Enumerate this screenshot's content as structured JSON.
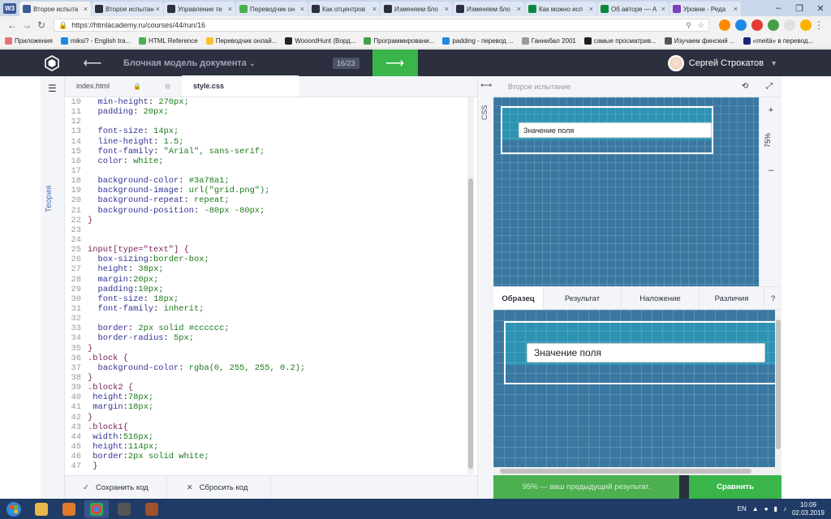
{
  "browser": {
    "tabs": [
      {
        "title": "Второе испыта",
        "fav_color": "#3d5a9a",
        "active": true
      },
      {
        "title": "Второе испытан",
        "fav_color": "#2b2f3e",
        "active": false
      },
      {
        "title": "Управление те",
        "fav_color": "#2b2f3e",
        "active": false
      },
      {
        "title": "Переводчик он",
        "fav_color": "#4caf50",
        "active": false
      },
      {
        "title": "Как отцентров",
        "fav_color": "#2b2f3e",
        "active": false
      },
      {
        "title": "Изменяем бло",
        "fav_color": "#2b2f3e",
        "active": false
      },
      {
        "title": "Изменяем бло",
        "fav_color": "#2b2f3e",
        "active": false
      },
      {
        "title": "Как можно исп",
        "fav_color": "#0b8a3e",
        "active": false
      },
      {
        "title": "Об авторе — А",
        "fav_color": "#0b8a3e",
        "active": false
      },
      {
        "title": "Уровни - Реда",
        "fav_color": "#7b3fbf",
        "active": false
      }
    ],
    "app_icon": "W3",
    "url": "https://htmlacademy.ru/courses/44/run/16",
    "bookmarks": [
      {
        "label": "Приложения",
        "color": "#e57373"
      },
      {
        "label": "miksi? - English tra...",
        "color": "#1e88e5"
      },
      {
        "label": "HTML Reference",
        "color": "#4caf50"
      },
      {
        "label": "Переводчик онлай...",
        "color": "#fbc02d"
      },
      {
        "label": "WooordHunt (Ворд...",
        "color": "#222222"
      },
      {
        "label": "Программировани...",
        "color": "#43a047"
      },
      {
        "label": "padding - перевод ...",
        "color": "#1e88e5"
      },
      {
        "label": "Ганнибал 2001",
        "color": "#999999"
      },
      {
        "label": "самые просматрив...",
        "color": "#1e1e1e"
      },
      {
        "label": "Изучаем финский ...",
        "color": "#555555"
      },
      {
        "label": "«meitä» в перевод...",
        "color": "#1a237e"
      }
    ]
  },
  "app": {
    "course_title": "Блочная модель документа",
    "counter": "16/23",
    "user_name": "Сергей Строкатов",
    "theory_label": "Теория",
    "files": {
      "html": "index.html",
      "css": "style.css"
    },
    "css_label": "CSS",
    "preview_title": "Второе испытание",
    "zoom": "75%",
    "field_value": "Значение поля",
    "preview_tabs": [
      "Образец",
      "Результат",
      "Наложение",
      "Различия",
      "?"
    ],
    "save_label": "Сохранить код",
    "reset_label": "Сбросить код",
    "result_message": "95% — ваш предыдущий результат.",
    "compare_label": "Сравнить"
  },
  "code_lines": [
    {
      "n": "10",
      "t": "  min-height: 270px;"
    },
    {
      "n": "11",
      "t": "  padding: 20px;"
    },
    {
      "n": "12",
      "t": ""
    },
    {
      "n": "13",
      "t": "  font-size: 14px;"
    },
    {
      "n": "14",
      "t": "  line-height: 1.5;"
    },
    {
      "n": "15",
      "t": "  font-family: \"Arial\", sans-serif;"
    },
    {
      "n": "16",
      "t": "  color: white;"
    },
    {
      "n": "17",
      "t": ""
    },
    {
      "n": "18",
      "t": "  background-color: #3a78a1;"
    },
    {
      "n": "19",
      "t": "  background-image: url(\"grid.png\");"
    },
    {
      "n": "20",
      "t": "  background-repeat: repeat;"
    },
    {
      "n": "21",
      "t": "  background-position: -80px -80px;"
    },
    {
      "n": "22",
      "t": "}"
    },
    {
      "n": "23",
      "t": ""
    },
    {
      "n": "24",
      "t": ""
    },
    {
      "n": "25",
      "t": "input[type=\"text\"] {"
    },
    {
      "n": "26",
      "t": "  box-sizing:border-box;"
    },
    {
      "n": "27",
      "t": "  height: 38px;"
    },
    {
      "n": "28",
      "t": "  margin:20px;"
    },
    {
      "n": "29",
      "t": "  padding:10px;"
    },
    {
      "n": "30",
      "t": "  font-size: 18px;"
    },
    {
      "n": "31",
      "t": "  font-family: inherit;"
    },
    {
      "n": "32",
      "t": ""
    },
    {
      "n": "33",
      "t": "  border: 2px solid #cccccc;"
    },
    {
      "n": "34",
      "t": "  border-radius: 5px;"
    },
    {
      "n": "35",
      "t": "}"
    },
    {
      "n": "36",
      "t": ".block {"
    },
    {
      "n": "37",
      "t": "  background-color: rgba(0, 255, 255, 0.2);"
    },
    {
      "n": "38",
      "t": "}"
    },
    {
      "n": "39",
      "t": ".block2 {"
    },
    {
      "n": "40",
      "t": " height:78px;"
    },
    {
      "n": "41",
      "t": " margin:18px;"
    },
    {
      "n": "42",
      "t": "}"
    },
    {
      "n": "43",
      "t": ".block1{"
    },
    {
      "n": "44",
      "t": " width:516px;"
    },
    {
      "n": "45",
      "t": " height:114px;"
    },
    {
      "n": "46",
      "t": " border:2px solid white;"
    },
    {
      "n": "47",
      "t": " }"
    }
  ],
  "taskbar": {
    "lang": "EN",
    "time": "10:09",
    "date": "02.03.2019"
  },
  "colors": {
    "header_bg": "#2b2f3e",
    "accent_green": "#39b54a",
    "grid_blue": "#3a78a1"
  }
}
